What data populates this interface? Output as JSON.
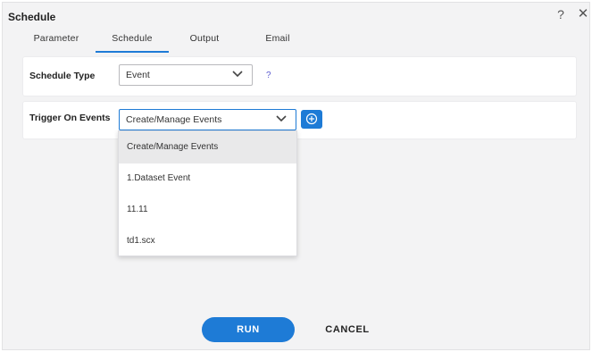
{
  "dialog": {
    "title": "Schedule",
    "help_icon": "question-icon",
    "help_label": "?",
    "close_icon": "close-icon",
    "close_label": "✕"
  },
  "tabs": [
    {
      "label": "Parameter",
      "active": false
    },
    {
      "label": "Schedule",
      "active": true
    },
    {
      "label": "Output",
      "active": false
    },
    {
      "label": "Email",
      "active": false
    }
  ],
  "schedule_type": {
    "label": "Schedule Type",
    "value": "Event",
    "help": "?"
  },
  "trigger": {
    "label": "Trigger On Events",
    "value": "Create/Manage Events",
    "add_icon": "plus-circle-icon"
  },
  "dropdown": {
    "options": [
      "Create/Manage Events",
      "1.Dataset Event",
      "11.11",
      "td1.scx"
    ],
    "selected": "Create/Manage Events"
  },
  "footer": {
    "run_label": "RUN",
    "cancel_label": "CANCEL"
  },
  "colors": {
    "accent": "#1e7bd6",
    "background": "#f3f3f4",
    "selected_option": "#e9e9ea"
  }
}
